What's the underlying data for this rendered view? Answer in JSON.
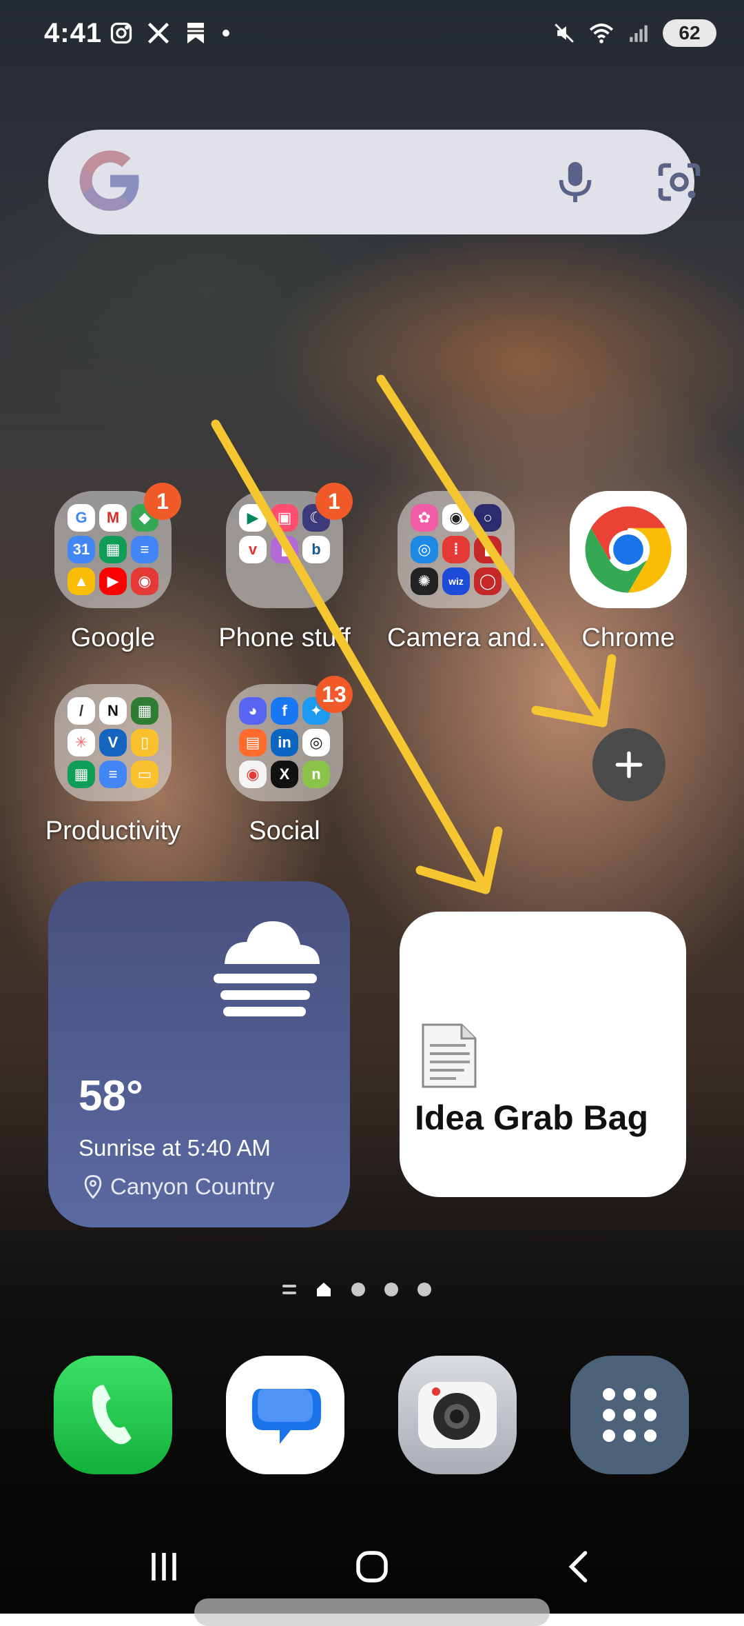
{
  "status_bar": {
    "time": "4:41",
    "battery": "62",
    "left_icons": [
      "instagram-icon",
      "x-icon",
      "bookmark-icon",
      "dot-icon"
    ],
    "right_icons": [
      "mute-icon",
      "wifi-icon",
      "signal-icon",
      "battery-icon"
    ]
  },
  "search_bar": {
    "icons": [
      "google-g-icon",
      "microphone-icon",
      "lens-camera-icon"
    ]
  },
  "home_items": [
    {
      "label": "Google",
      "type": "folder",
      "badge": "1"
    },
    {
      "label": "Phone stuff",
      "type": "folder",
      "badge": "1"
    },
    {
      "label": "Camera and...",
      "type": "folder",
      "badge": ""
    },
    {
      "label": "Chrome",
      "type": "app",
      "badge": ""
    },
    {
      "label": "Productivity",
      "type": "folder",
      "badge": ""
    },
    {
      "label": "Social",
      "type": "folder",
      "badge": "13"
    }
  ],
  "weather_widget": {
    "temperature": "58°",
    "sunrise": "Sunrise at 5:40 AM",
    "location": "Canyon Country",
    "icon": "fog-cloud-icon"
  },
  "note_widget": {
    "title": "Idea Grab Bag",
    "icon": "document-icon"
  },
  "page_indicator": {
    "pages": 4,
    "current": 1
  },
  "dock": [
    "phone-app",
    "messages-app",
    "camera-app",
    "app-drawer"
  ],
  "colors": {
    "badge": "#f05a28",
    "annotation_arrow": "#f6c630",
    "weather_bg": "#4e5a8e",
    "plus_button": "#4b4b4b"
  }
}
